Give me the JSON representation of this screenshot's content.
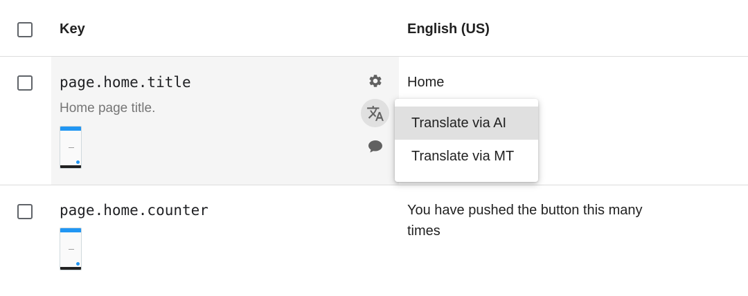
{
  "table": {
    "header": {
      "key_label": "Key",
      "language_label": "English (US)"
    },
    "rows": [
      {
        "key": "page.home.title",
        "description": "Home page title.",
        "value": "Home"
      },
      {
        "key": "page.home.counter",
        "description": "",
        "value": "You have pushed the button this many times"
      }
    ]
  },
  "translate_menu": {
    "items": [
      {
        "label": "Translate via AI"
      },
      {
        "label": "Translate via MT"
      }
    ]
  },
  "icons": {
    "settings": "gear-icon",
    "translate": "translate-icon",
    "comment": "comment-icon"
  },
  "colors": {
    "hover_row_bg": "#f5f5f5",
    "menu_highlight": "#e0e0e0",
    "divider": "#dcdcdc",
    "icon": "#616161"
  }
}
